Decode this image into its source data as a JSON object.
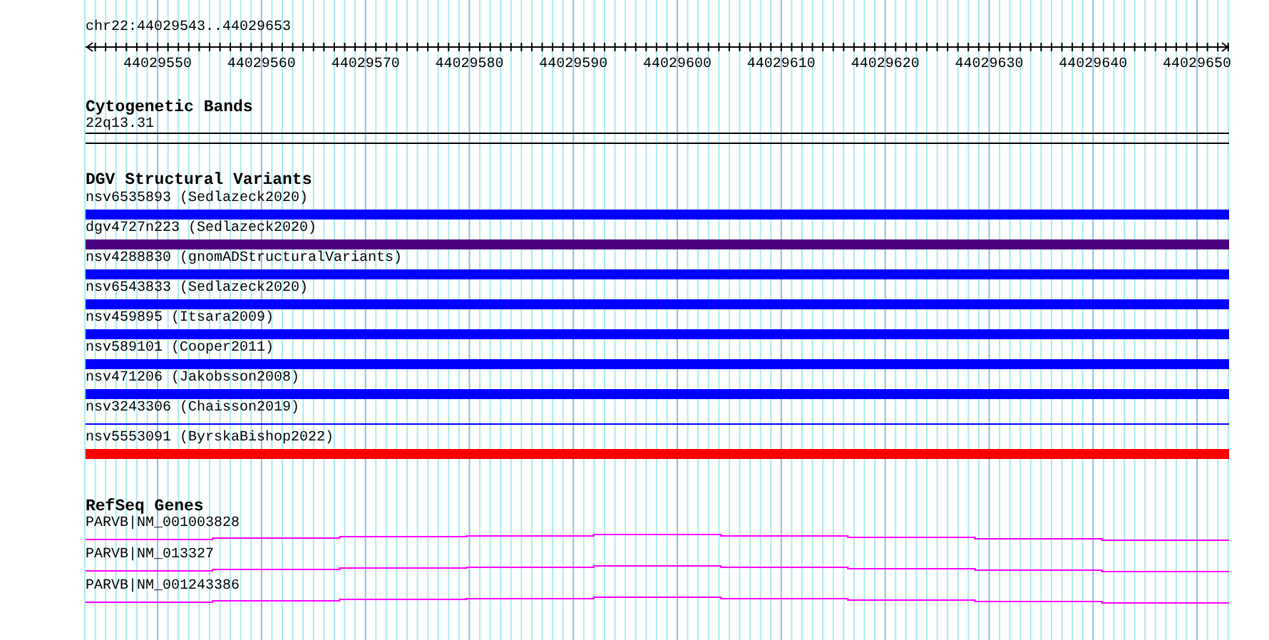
{
  "ruler": {
    "location": "chr22:44029543..44029653",
    "ticks": [
      "44029550",
      "44029560",
      "44029570",
      "44029580",
      "44029590",
      "44029600",
      "44029610",
      "44029620",
      "44029630",
      "44029640",
      "44029650"
    ]
  },
  "cytogenetic_bands": {
    "title": "Cytogenetic Bands",
    "band": "22q13.31"
  },
  "dgv_structural_variants": {
    "title": "DGV Structural Variants",
    "items": [
      {
        "label": "nsv6535893 (Sedlazeck2020)",
        "color": "#0000ff",
        "kind": "bar"
      },
      {
        "label": "dgv4727n223 (Sedlazeck2020)",
        "color": "#4b0082",
        "kind": "bar"
      },
      {
        "label": "nsv4288830 (gnomADStructuralVariants)",
        "color": "#0000ff",
        "kind": "bar"
      },
      {
        "label": "nsv6543833 (Sedlazeck2020)",
        "color": "#0000ff",
        "kind": "bar"
      },
      {
        "label": "nsv459895 (Itsara2009)",
        "color": "#0000ff",
        "kind": "bar"
      },
      {
        "label": "nsv589101 (Cooper2011)",
        "color": "#0000ff",
        "kind": "bar"
      },
      {
        "label": "nsv471206 (Jakobsson2008)",
        "color": "#0000ff",
        "kind": "bar"
      },
      {
        "label": "nsv3243306 (Chaisson2019)",
        "color": "#0000ff",
        "kind": "line"
      },
      {
        "label": "nsv5553091 (ByrskaBishop2022)",
        "color": "#ff0000",
        "kind": "bar"
      }
    ]
  },
  "refseq_genes": {
    "title": "RefSeq Genes",
    "items": [
      {
        "label": "PARVB|NM_001003828"
      },
      {
        "label": "PARVB|NM_013327"
      },
      {
        "label": "PARVB|NM_001243386"
      }
    ]
  }
}
